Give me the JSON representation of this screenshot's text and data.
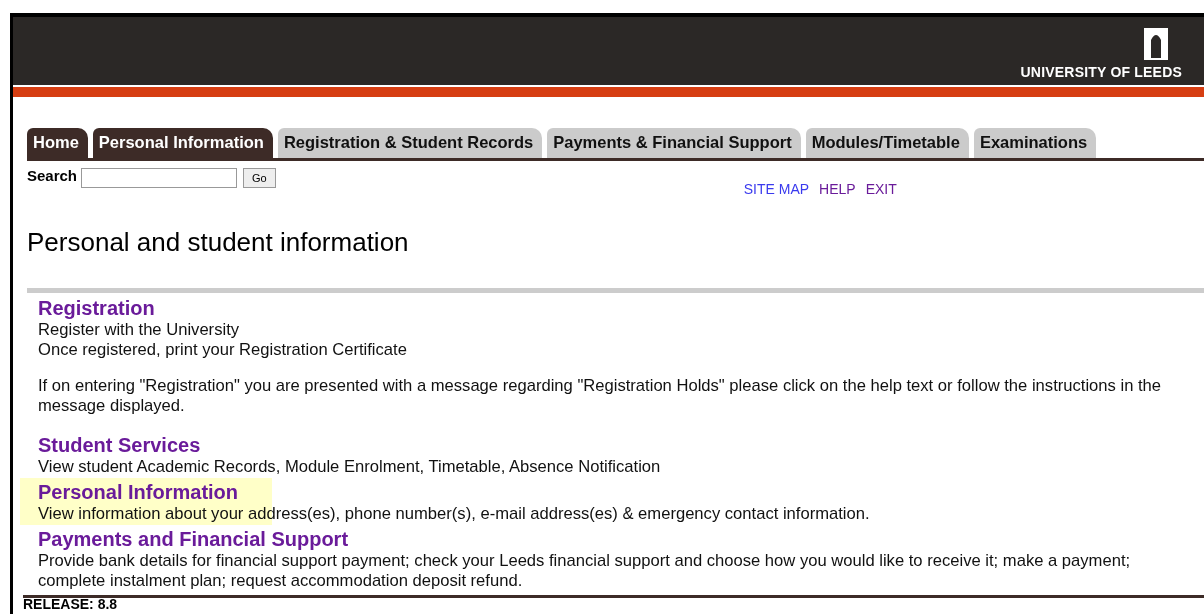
{
  "header": {
    "logo_text": "UNIVERSITY OF LEEDS"
  },
  "tabs": [
    {
      "label": "Home",
      "selected": true
    },
    {
      "label": "Personal Information",
      "selected": true
    },
    {
      "label": "Registration & Student Records",
      "selected": false
    },
    {
      "label": "Payments & Financial Support",
      "selected": false
    },
    {
      "label": "Modules/Timetable",
      "selected": false
    },
    {
      "label": "Examinations",
      "selected": false
    }
  ],
  "search": {
    "label": "Search",
    "button": "Go"
  },
  "links": [
    "SITE MAP",
    "HELP",
    "EXIT"
  ],
  "title": "Personal and student information",
  "sections": [
    {
      "heading": "Registration",
      "highlighted": false,
      "lines": [
        "Register with the University",
        "Once registered, print your Registration Certificate"
      ],
      "note": "If on entering \"Registration\" you are presented with a message regarding \"Registration Holds\" please click on the help text or follow the instructions in the message displayed."
    },
    {
      "heading": "Student Services",
      "highlighted": false,
      "lines": [
        "View student Academic Records, Module Enrolment, Timetable, Absence Notification"
      ]
    },
    {
      "heading": "Personal Information",
      "highlighted": true,
      "lines": [
        "View information about your address(es), phone number(s), e-mail address(es) & emergency contact information."
      ]
    },
    {
      "heading": "Payments and Financial Support",
      "highlighted": false,
      "lines": [
        "Provide bank details for financial support payment; check your Leeds financial support and choose how you would like to receive it; make a payment; complete instalment plan; request accommodation deposit refund."
      ]
    }
  ],
  "release": "RELEASE: 8.8"
}
